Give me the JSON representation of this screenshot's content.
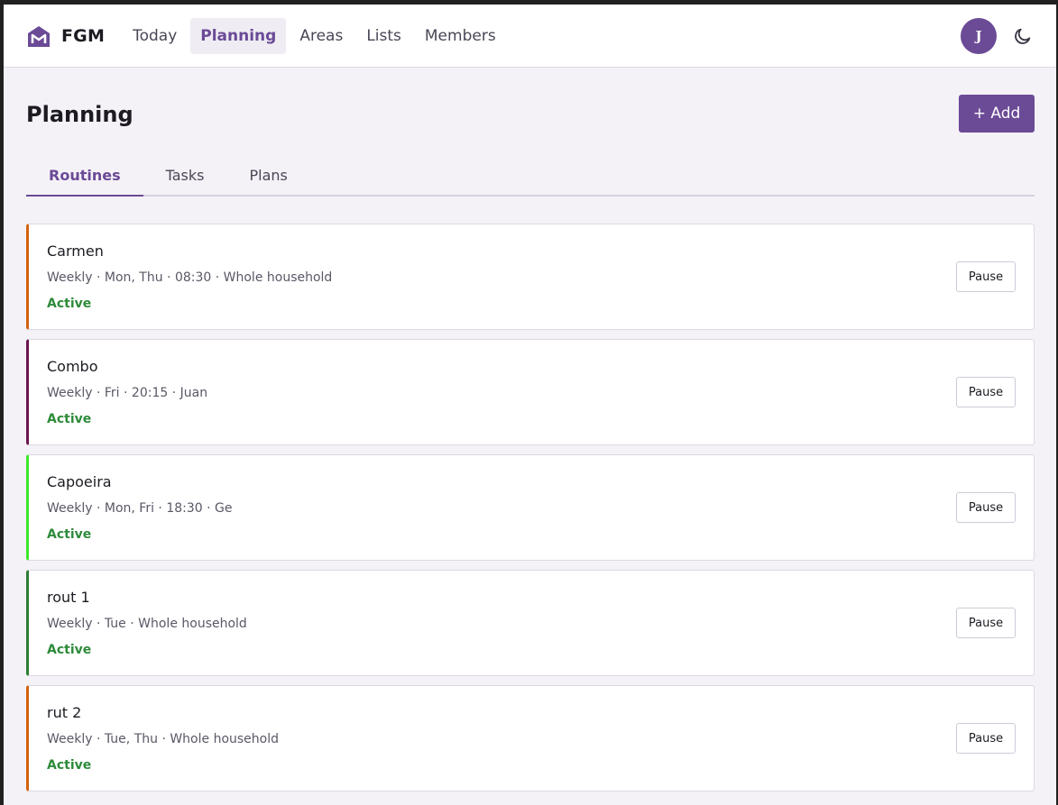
{
  "app": {
    "name": "FGM"
  },
  "nav": [
    {
      "label": "Today",
      "active": false
    },
    {
      "label": "Planning",
      "active": true
    },
    {
      "label": "Areas",
      "active": false
    },
    {
      "label": "Lists",
      "active": false
    },
    {
      "label": "Members",
      "active": false
    }
  ],
  "user": {
    "initial": "J"
  },
  "page": {
    "title": "Planning",
    "add_label": "+ Add"
  },
  "tabs": [
    {
      "label": "Routines",
      "active": true
    },
    {
      "label": "Tasks",
      "active": false
    },
    {
      "label": "Plans",
      "active": false
    }
  ],
  "routines": [
    {
      "title": "Carmen",
      "meta": "Weekly · Mon, Thu · 08:30 · Whole household",
      "status": "Active",
      "action": "Pause",
      "color": "#d4620f"
    },
    {
      "title": "Combo",
      "meta": "Weekly · Fri · 20:15 · Juan",
      "status": "Active",
      "action": "Pause",
      "color": "#6a1550"
    },
    {
      "title": "Capoeira",
      "meta": "Weekly · Mon, Fri · 18:30 · Ge",
      "status": "Active",
      "action": "Pause",
      "color": "#3ee82a"
    },
    {
      "title": "rout 1",
      "meta": "Weekly · Tue · Whole household",
      "status": "Active",
      "action": "Pause",
      "color": "#2e7d32"
    },
    {
      "title": "rut 2",
      "meta": "Weekly · Tue, Thu · Whole household",
      "status": "Active",
      "action": "Pause",
      "color": "#d4620f"
    }
  ],
  "colors": {
    "accent": "#6b4a96",
    "status_active": "#2e8b3a"
  },
  "icons": {
    "logo": "house-m-logo-icon",
    "theme": "moon-icon"
  }
}
